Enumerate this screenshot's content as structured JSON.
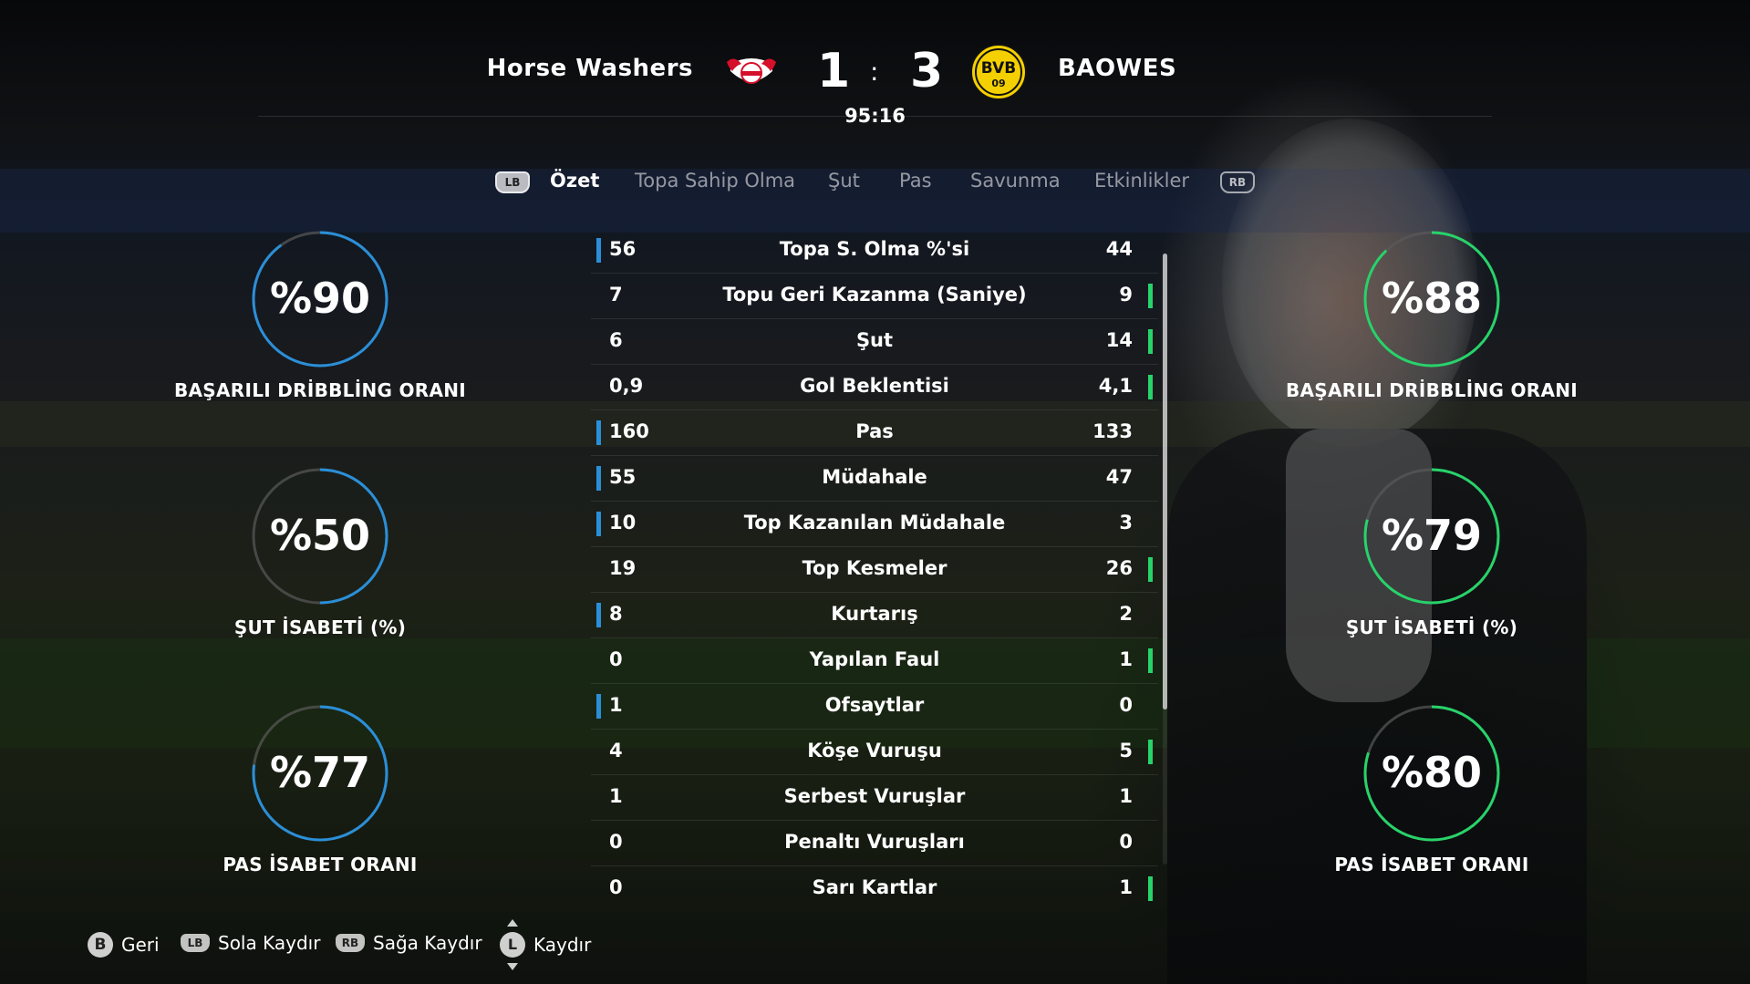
{
  "match": {
    "home_team": "Horse Washers",
    "away_team": "BAOWES",
    "home_score": "1",
    "away_score": "3",
    "separator": ":",
    "clock": "95:16"
  },
  "colors": {
    "home_accent": "#2a8fd8",
    "away_accent": "#27d36a",
    "away_crest_yellow": "#f5d000"
  },
  "tabs": {
    "left_shoulder": "LB",
    "right_shoulder": "RB",
    "items": [
      {
        "label": "Özet",
        "active": true
      },
      {
        "label": "Topa Sahip Olma",
        "active": false
      },
      {
        "label": "Şut",
        "active": false
      },
      {
        "label": "Pas",
        "active": false
      },
      {
        "label": "Savunma",
        "active": false
      },
      {
        "label": "Etkinlikler",
        "active": false
      }
    ]
  },
  "home_gauges": [
    {
      "value": "%90",
      "fraction": 0.9,
      "label": "BAŞARILI DRİBBLİNG ORANI"
    },
    {
      "value": "%50",
      "fraction": 0.5,
      "label": "ŞUT İSABETİ (%)"
    },
    {
      "value": "%77",
      "fraction": 0.77,
      "label": "PAS İSABET ORANI"
    }
  ],
  "away_gauges": [
    {
      "value": "%88",
      "fraction": 0.88,
      "label": "BAŞARILI DRİBBLİNG ORANI"
    },
    {
      "value": "%79",
      "fraction": 0.79,
      "label": "ŞUT İSABETİ (%)"
    },
    {
      "value": "%80",
      "fraction": 0.8,
      "label": "PAS İSABET ORANI"
    }
  ],
  "stats": [
    {
      "label": "Topa S. Olma %'si",
      "home": "56",
      "away": "44",
      "leader": "home"
    },
    {
      "label": "Topu Geri Kazanma (Saniye)",
      "home": "7",
      "away": "9",
      "leader": "away"
    },
    {
      "label": "Şut",
      "home": "6",
      "away": "14",
      "leader": "away"
    },
    {
      "label": "Gol Beklentisi",
      "home": "0,9",
      "away": "4,1",
      "leader": "away"
    },
    {
      "label": "Pas",
      "home": "160",
      "away": "133",
      "leader": "home"
    },
    {
      "label": "Müdahale",
      "home": "55",
      "away": "47",
      "leader": "home"
    },
    {
      "label": "Top Kazanılan Müdahale",
      "home": "10",
      "away": "3",
      "leader": "home"
    },
    {
      "label": "Top Kesmeler",
      "home": "19",
      "away": "26",
      "leader": "away"
    },
    {
      "label": "Kurtarış",
      "home": "8",
      "away": "2",
      "leader": "home"
    },
    {
      "label": "Yapılan Faul",
      "home": "0",
      "away": "1",
      "leader": "away"
    },
    {
      "label": "Ofsaytlar",
      "home": "1",
      "away": "0",
      "leader": "home"
    },
    {
      "label": "Köşe Vuruşu",
      "home": "4",
      "away": "5",
      "leader": "away"
    },
    {
      "label": "Serbest Vuruşlar",
      "home": "1",
      "away": "1",
      "leader": "none"
    },
    {
      "label": "Penaltı Vuruşları",
      "home": "0",
      "away": "0",
      "leader": "none"
    },
    {
      "label": "Sarı Kartlar",
      "home": "0",
      "away": "1",
      "leader": "away"
    }
  ],
  "footer": {
    "back_key": "B",
    "back_label": "Geri",
    "left_key": "LB",
    "left_label": "Sola Kaydır",
    "right_key": "RB",
    "right_label": "Sağa Kaydır",
    "scroll_key": "L",
    "scroll_label": "Kaydır"
  }
}
